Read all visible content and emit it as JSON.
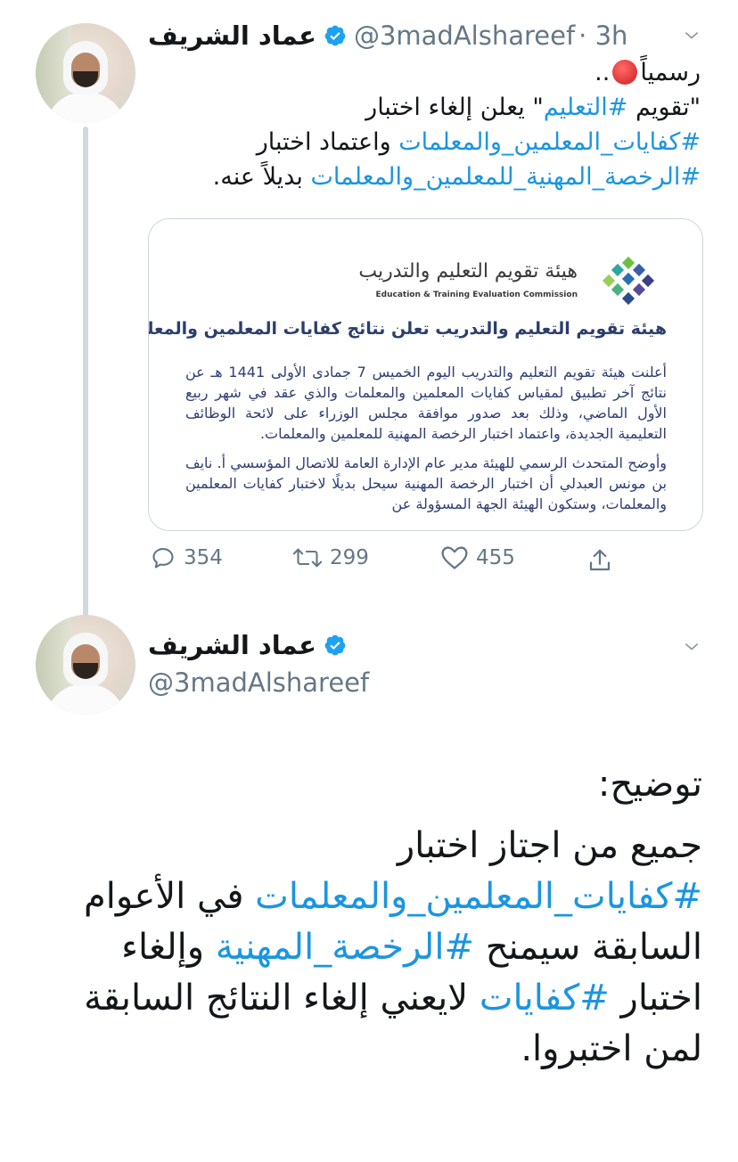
{
  "thread_tweet": {
    "author_name": "عماد الشريف",
    "handle": "@3madAlshareef",
    "time": "· 3h",
    "text_line1_prefix": "..",
    "text_line1_emoji": "🔴",
    "text_line1_word": "رسمياً",
    "text_line2": {
      "q1": "\"تقويم ",
      "tag": "#التعليم",
      "q2": "\" يعلن إلغاء اختبار"
    },
    "text_line3": {
      "tag": "#كفايات_المعلمين_والمعلمات",
      "rest": " واعتماد اختبار"
    },
    "text_line4": {
      "tag": "#الرخصة_المهنية_للمعلمين_والمعلمات",
      "rest": " بديلاً عنه."
    },
    "card": {
      "logo_ar": "هيئة تقويم التعليم والتدريب",
      "logo_en": "Education & Training Evaluation Commission",
      "headline": "هيئة تقويم التعليم والتدريب تعلن نتائج كفايات المعلمين والمعلمات",
      "paragraph1": "أعلنت هيئة تقويم التعليم والتدريب اليوم الخميس 7 جمادى الأولى 1441 هـ عن نتائج آخر تطبيق لمقياس كفايات المعلمين والمعلمات والذي عقد في شهر ربيع الأول الماضي، وذلك بعد صدور موافقة مجلس الوزراء على لائحة الوظائف التعليمية الجديدة، واعتماد اختبار الرخصة المهنية للمعلمين والمعلمات.",
      "paragraph2": "وأوضح المتحدث الرسمي للهيئة مدير عام الإدارة العامة للاتصال المؤسسي أ. نايف بن مونس العبدلي أن اختبار الرخصة المهنية سيحل بديلًا لاختبار كفايات المعلمين والمعلمات، وستكون الهيئة الجهة المسؤولة عن"
    },
    "actions": {
      "replies": "354",
      "retweets": "299",
      "likes": "455"
    }
  },
  "main_tweet": {
    "author_name": "عماد الشريف",
    "handle": "@3madAlshareef",
    "line1": "توضيح:",
    "line2": "جميع من اجتاز اختبار",
    "line3": {
      "tag": "#كفايات_المعلمين_والمعلمات",
      "rest": " في الأعوام"
    },
    "line4": {
      "pre": "السابقة سيمنح ",
      "tag": "#الرخصة_المهنية",
      "rest": " وإلغاء"
    },
    "line5": {
      "pre": "اختبار ",
      "tag": "#كفايات",
      "rest": " لايعني إلغاء النتائج السابقة"
    },
    "line6": "لمن اختبروا."
  },
  "colors": {
    "link": "#1b95e0",
    "verified": "#1da1f2",
    "muted": "#657786",
    "thread_line": "#cfd9de"
  },
  "icons": [
    "verified-badge-icon",
    "chevron-down-icon",
    "reply-icon",
    "retweet-icon",
    "like-icon",
    "share-icon",
    "red-circle-emoji"
  ]
}
